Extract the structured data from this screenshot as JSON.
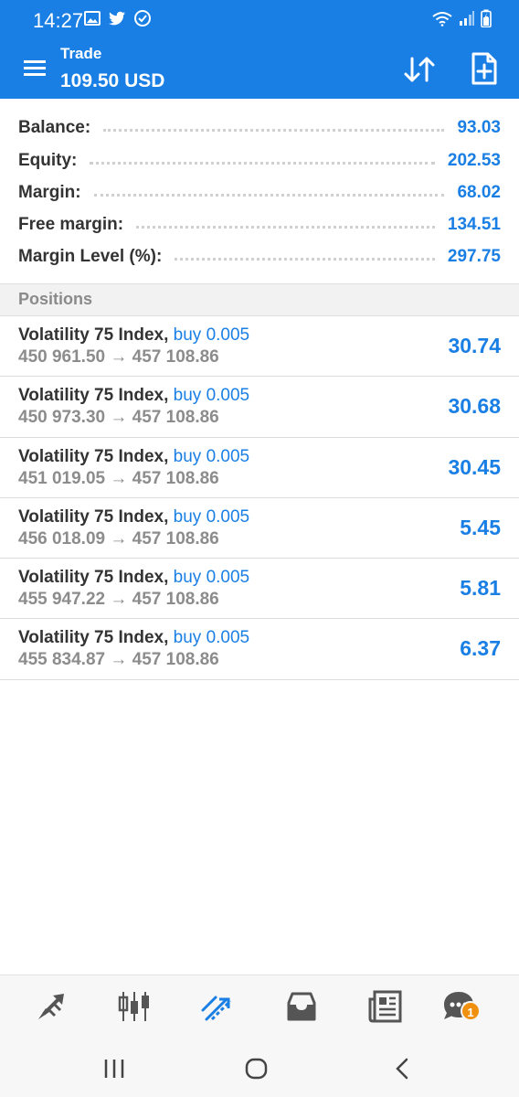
{
  "status_bar": {
    "time": "14:27"
  },
  "app_bar": {
    "title": "Trade",
    "subtitle": "109.50 USD"
  },
  "summary": [
    {
      "label": "Balance:",
      "value": "93.03"
    },
    {
      "label": "Equity:",
      "value": "202.53"
    },
    {
      "label": "Margin:",
      "value": "68.02"
    },
    {
      "label": "Free margin:",
      "value": "134.51"
    },
    {
      "label": "Margin Level (%):",
      "value": "297.75"
    }
  ],
  "positions_header": "Positions",
  "positions": [
    {
      "symbol": "Volatility 75 Index,",
      "type": "buy 0.005",
      "prices": "450 961.50 → 457 108.86",
      "profit": "30.74"
    },
    {
      "symbol": "Volatility 75 Index,",
      "type": "buy 0.005",
      "prices": "450 973.30 → 457 108.86",
      "profit": "30.68"
    },
    {
      "symbol": "Volatility 75 Index,",
      "type": "buy 0.005",
      "prices": "451 019.05 → 457 108.86",
      "profit": "30.45"
    },
    {
      "symbol": "Volatility 75 Index,",
      "type": "buy 0.005",
      "prices": "456 018.09 → 457 108.86",
      "profit": "5.45"
    },
    {
      "symbol": "Volatility 75 Index,",
      "type": "buy 0.005",
      "prices": "455 947.22 → 457 108.86",
      "profit": "5.81"
    },
    {
      "symbol": "Volatility 75 Index,",
      "type": "buy 0.005",
      "prices": "455 834.87 → 457 108.86",
      "profit": "6.37"
    }
  ],
  "tabbar": {
    "tabs": [
      "quotes-icon",
      "chart-icon",
      "trade-icon",
      "history-icon",
      "news-icon",
      "messages-icon"
    ],
    "active": "trade-icon",
    "messages_badge": "1"
  },
  "colors": {
    "accent": "#1a7fe4",
    "badge": "#f0900f",
    "muted": "#8c8c8c"
  }
}
